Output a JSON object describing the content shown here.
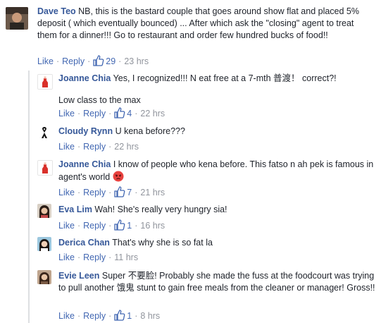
{
  "top": {
    "name": "Dave Teo",
    "text": "NB, this is the bastard couple that goes around show flat and placed 5% deposit ( which eventually bounced) ... After which ask the \"closing\" agent to treat them for a dinner!!! Go to restaurant and order few hundred bucks of food!!",
    "like": "Like",
    "reply": "Reply",
    "likes": "29",
    "time": "23 hrs"
  },
  "replies": [
    {
      "name": "Joanne Chia",
      "text": "Yes, I recognized!!! N eat free at a 7-mth 普渡！ correct?!",
      "text2": "Low class to the max",
      "like": "Like",
      "reply": "Reply",
      "likes": "4",
      "time": "22 hrs"
    },
    {
      "name": "Cloudy Rynn",
      "text": "U kena before???",
      "like": "Like",
      "reply": "Reply",
      "time": "22 hrs"
    },
    {
      "name": "Joanne Chia",
      "text": "I know of people who kena before. This fatso n ah pek is famous in agent's world",
      "like": "Like",
      "reply": "Reply",
      "likes": "7",
      "time": "21 hrs"
    },
    {
      "name": "Eva Lim",
      "text": "Wah! She's really very hungry sia!",
      "like": "Like",
      "reply": "Reply",
      "likes": "1",
      "time": "16 hrs"
    },
    {
      "name": "Derica Chan",
      "text": "That's why she is so fat la",
      "like": "Like",
      "reply": "Reply",
      "time": "11 hrs"
    },
    {
      "name": "Evie Leen",
      "text": "Super 不要脸! Probably she made the fuss at the foodcourt was trying to pull another 饿鬼 stunt to gain free meals from the cleaner or manager! Gross!!",
      "like": "Like",
      "reply": "Reply",
      "likes": "1",
      "time": "8 hrs"
    }
  ],
  "icons": {
    "like": "thumbs-up-icon",
    "emoji": "angry-face-icon",
    "ribbon": "black-ribbon-icon"
  },
  "colors": {
    "name": "#365899",
    "link": "#4267b2",
    "meta": "#90949c",
    "text": "#1d2129"
  }
}
